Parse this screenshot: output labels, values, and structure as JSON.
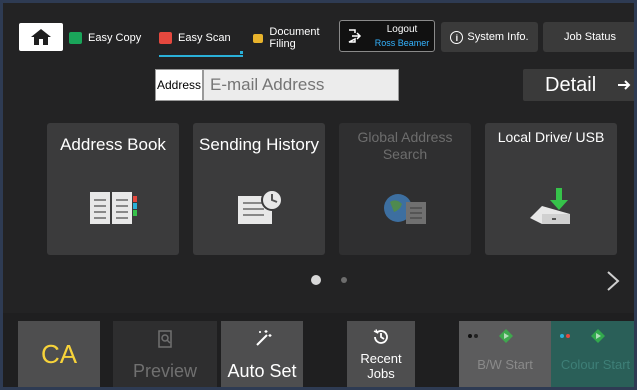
{
  "topbar": {
    "easy_copy": "Easy Copy",
    "easy_scan": "Easy Scan",
    "document_filing": "Document Filing",
    "logout_label": "Logout",
    "logout_user": "Ross Beamer",
    "system_info": "System Info.",
    "job_status": "Job Status"
  },
  "address": {
    "label": "Address",
    "placeholder": "E-mail Address"
  },
  "detail_label": "Detail",
  "tiles": [
    {
      "label": "Address Book",
      "enabled": true
    },
    {
      "label": "Sending History",
      "enabled": true
    },
    {
      "label": "Global Address Search",
      "enabled": false
    },
    {
      "label": "Local Drive/ USB",
      "enabled": true
    }
  ],
  "pagination": {
    "current": 1,
    "total": 2
  },
  "bottombar": {
    "ca": "CA",
    "preview": "Preview",
    "auto_set": "Auto Set",
    "recent_jobs": "Recent Jobs",
    "bw_start": "B/W Start",
    "colour_start": "Colour Start"
  },
  "colors": {
    "easy_copy_icon": "#1aa55a",
    "easy_scan_icon": "#e5483e",
    "document_filing_icon": "#e8b32c",
    "active_underline": "#2ab0d8",
    "user_name": "#34b3ff",
    "ca_text": "#f7d33a",
    "colour_start_bg": "#2a5f58",
    "start_icon": "#36c24a"
  },
  "icons": {
    "home": "home-icon",
    "address_book": "address-book-icon",
    "sending_history": "sending-history-icon",
    "global_address_search": "globe-directory-icon",
    "local_drive": "usb-drive-icon",
    "preview": "magnifier-document-icon",
    "auto_set": "magic-wand-icon",
    "recent_jobs": "history-clock-icon",
    "start": "diamond-start-icon"
  }
}
